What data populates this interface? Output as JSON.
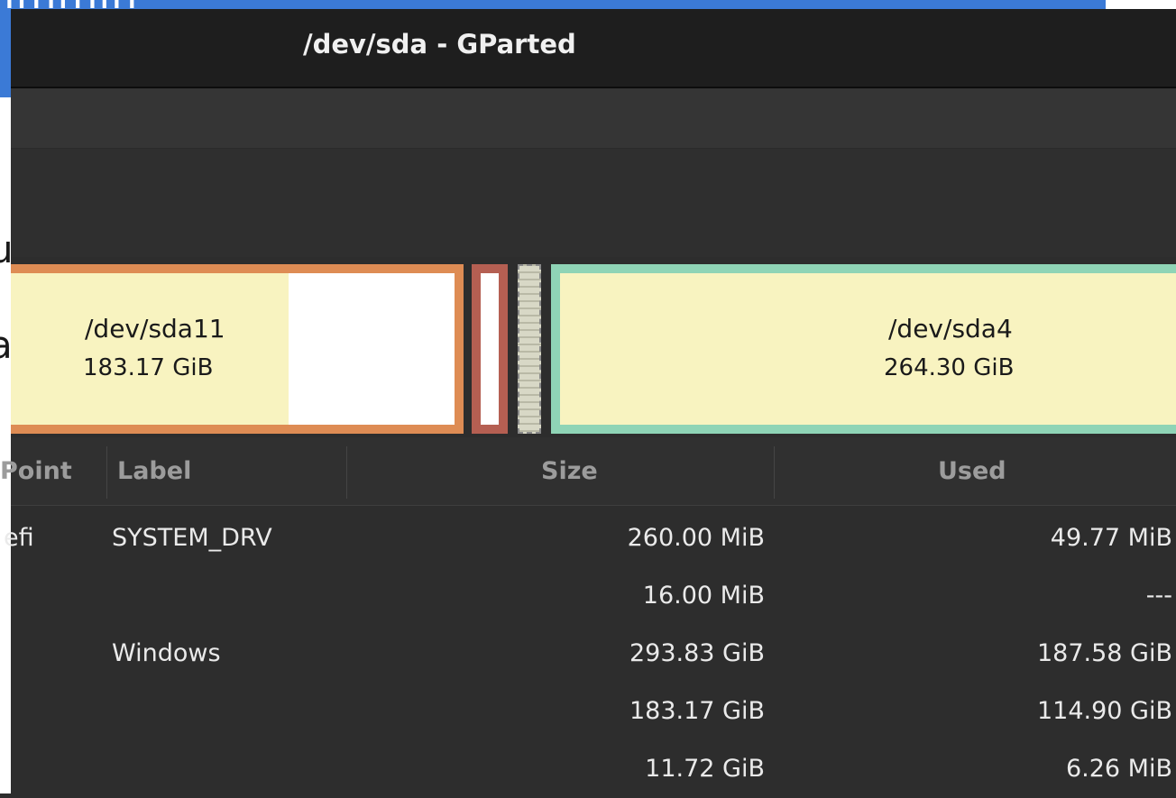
{
  "background": {
    "titlebar_fragment": "ımmın",
    "doc_fragment_1": "u",
    "doc_fragment_2": "a"
  },
  "window": {
    "title": "/dev/sda - GParted"
  },
  "partition_map": {
    "sda11": {
      "name": "/dev/sda11",
      "size": "183.17 GiB",
      "used_fraction": 0.627,
      "border_color": "#de8c54"
    },
    "small": {
      "border_color": "#b55f52"
    },
    "sda4": {
      "name": "/dev/sda4",
      "size": "264.30 GiB",
      "border_color": "#8fd4b6"
    }
  },
  "table": {
    "headers": {
      "mount_point": "Point",
      "label": "Label",
      "size": "Size",
      "used": "Used"
    },
    "rows": [
      {
        "mount_point": "efi",
        "label": "SYSTEM_DRV",
        "size": "260.00 MiB",
        "used": "49.77 MiB"
      },
      {
        "mount_point": "",
        "label": "",
        "size": "16.00 MiB",
        "used": "---"
      },
      {
        "mount_point": "",
        "label": "Windows",
        "size": "293.83 GiB",
        "used": "187.58 GiB"
      },
      {
        "mount_point": "",
        "label": "",
        "size": "183.17 GiB",
        "used": "114.90 GiB"
      },
      {
        "mount_point": "",
        "label": "",
        "size": "11.72 GiB",
        "used": "6.26 MiB"
      }
    ]
  }
}
